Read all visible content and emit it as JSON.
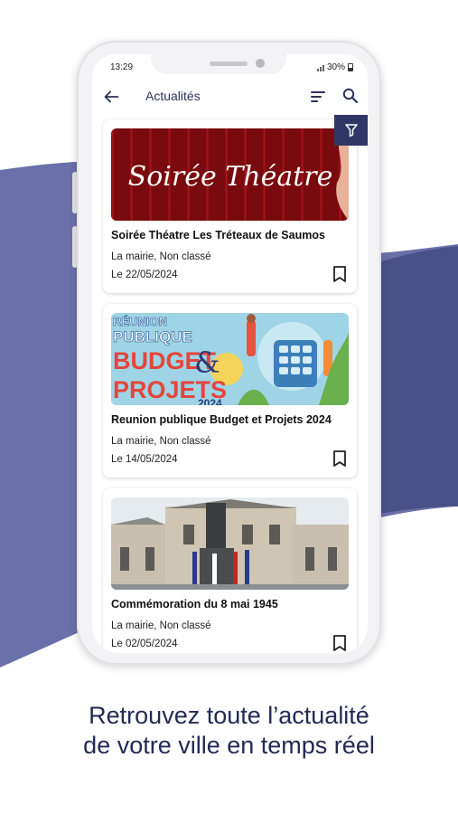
{
  "status_bar": {
    "time": "13:29",
    "battery": "30%"
  },
  "app_bar": {
    "title": "Actualités",
    "back_icon": "arrow-left-icon",
    "sort_icon": "sort-icon",
    "search_icon": "search-icon"
  },
  "filter_icon": "filter-icon",
  "articles": [
    {
      "image_text": "Soirée Théatre",
      "title": "Soirée Théatre Les Tréteaux de Saumos",
      "category": "La mairie, Non classé",
      "date": "Le 22/05/2024"
    },
    {
      "image_text": [
        "RÉUNION",
        "PUBLIQUE",
        "BUDGET",
        "&",
        "PROJETS",
        "2024"
      ],
      "title": "Reunion publique Budget et Projets 2024",
      "category": "La mairie, Non classé",
      "date": "Le 14/05/2024"
    },
    {
      "title": "Commémoration du 8 mai 1945",
      "category": "La mairie, Non classé",
      "date": "Le 02/05/2024"
    }
  ],
  "caption": {
    "line1": "Retrouvez toute l’actualité",
    "line2": "de votre ville en temps réel"
  },
  "colors": {
    "brand": "#303766",
    "wave": "#6b70aa",
    "wave_dark": "#3d4680",
    "title": "#2c3259"
  }
}
